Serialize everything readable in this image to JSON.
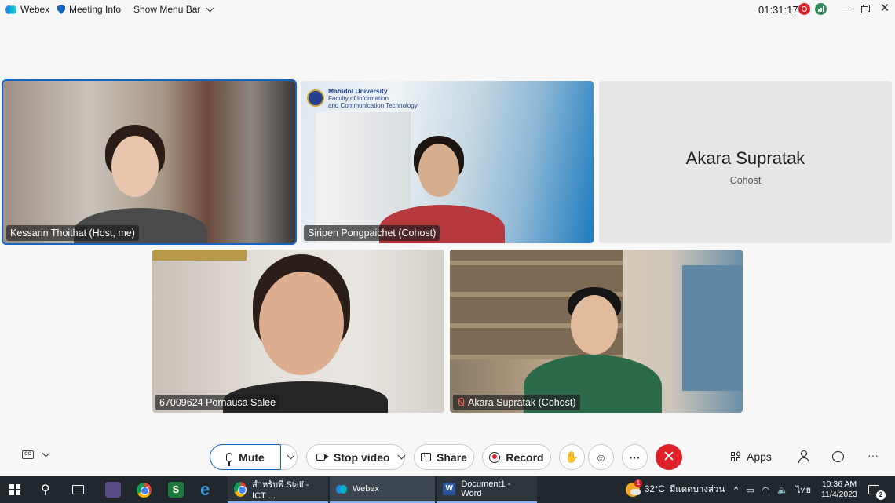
{
  "topbar": {
    "app_name": "Webex",
    "meeting_info_label": "Meeting Info",
    "show_menu_label": "Show Menu Bar",
    "timer": "01:31:17"
  },
  "participants": [
    {
      "name": "Kessarin Thoithat (Host, me)",
      "video": true,
      "active_speaker": true
    },
    {
      "name": "Siripen Pongpaichet (Cohost)",
      "video": true,
      "background_text": [
        "Mahidol University",
        "Faculty of Information",
        "and Communication Technology"
      ]
    },
    {
      "name": "Akara Supratak",
      "role": "Cohost",
      "video": false
    },
    {
      "name": "67009624 Pornausa Salee",
      "video": true
    },
    {
      "name": "Akara Supratak (Cohost)",
      "video": true,
      "muted": true
    }
  ],
  "controls": {
    "mute_label": "Mute",
    "stop_video_label": "Stop video",
    "share_label": "Share",
    "record_label": "Record",
    "more_label": "···",
    "end_label": "✕",
    "apps_label": "Apps",
    "overflow_label": "···"
  },
  "taskbar": {
    "items": [
      {
        "label": "สำหรับพี่ Staff - ICT ...",
        "icon": "chrome-icon"
      },
      {
        "label": "Webex",
        "icon": "webex-icon",
        "active": true
      },
      {
        "label": "Document1 - Word",
        "icon": "word-icon"
      }
    ],
    "weather_temp": "32°C",
    "weather_desc": "มีแดดบางส่วน",
    "weather_badge": "1",
    "language": "ไทย",
    "time": "10:36 AM",
    "date": "11/4/2023",
    "notification_count": "2"
  },
  "colors": {
    "accent": "#1565c0",
    "end_call": "#e0212b",
    "taskbar": "#20282e"
  }
}
